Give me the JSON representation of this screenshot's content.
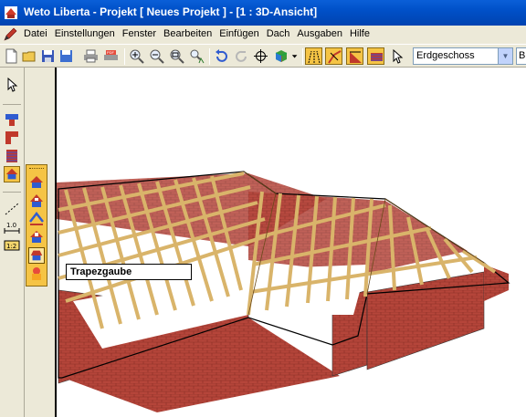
{
  "window": {
    "title": "Weto Liberta - Projekt [ Neues Projekt ] - [1 : 3D-Ansicht]"
  },
  "menu": {
    "items": [
      "Datei",
      "Einstellungen",
      "Fenster",
      "Bearbeiten",
      "Einfügen",
      "Dach",
      "Ausgaben",
      "Hilfe"
    ]
  },
  "toolbar": {
    "floor_selected": "Erdgeschoss",
    "second_select_visible": "B",
    "icons": [
      "new-file-icon",
      "open-folder-icon",
      "save-icon",
      "save-as-icon",
      "print-icon",
      "print-preview-icon",
      "zoom-in-icon",
      "zoom-out-icon",
      "zoom-window-icon",
      "zoom-walk-icon",
      "undo-icon",
      "redo-icon",
      "move-crosshair-icon",
      "cube-3d-icon",
      "roof-view-a-icon",
      "roof-view-b-icon",
      "roof-view-c-icon",
      "roof-view-d-icon",
      "pointer-icon"
    ]
  },
  "left_toolbar": {
    "icons": [
      "select-arrow-icon",
      "wall-icon",
      "corner-icon",
      "pattern-icon",
      "house-icon",
      "dimension-line-icon",
      "dimension-icon",
      "scale-icon"
    ],
    "labels": {
      "dimension": "1.0",
      "scale": "1:2"
    }
  },
  "sub_toolbar": {
    "icons": [
      "roof-icon",
      "dormer-icon",
      "gable-icon",
      "window-roof-icon",
      "trapezoid-dormer-icon",
      "skylight-icon"
    ]
  },
  "tooltip": {
    "text": "Trapezgaube"
  },
  "colors": {
    "titlebar": "#0050c8",
    "accent_active": "#f5c445",
    "brick": "#b5453a",
    "timber": "#e8c98a"
  }
}
